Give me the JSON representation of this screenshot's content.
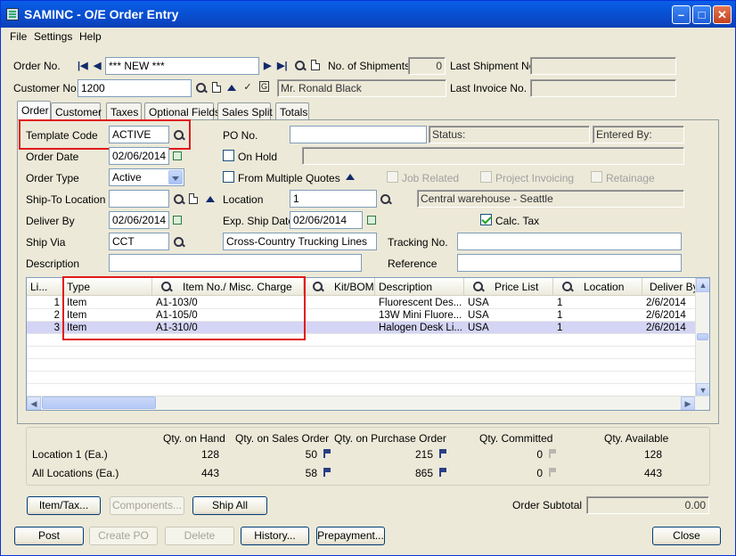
{
  "window": {
    "title": "SAMINC - O/E Order Entry"
  },
  "menu": [
    "File",
    "Settings",
    "Help"
  ],
  "header": {
    "order_no_label": "Order No.",
    "order_no_value": "*** NEW ***",
    "num_shipments_label": "No. of Shipments",
    "num_shipments_value": "0",
    "last_shipment_label": "Last Shipment No.",
    "last_shipment_value": "",
    "customer_no_label": "Customer No.",
    "customer_no_value": "1200",
    "customer_name": "Mr. Ronald Black",
    "last_invoice_label": "Last Invoice No.",
    "last_invoice_value": ""
  },
  "tabs": [
    "Order",
    "Customer",
    "Taxes",
    "Optional Fields",
    "Sales Split",
    "Totals"
  ],
  "order_tab": {
    "template_code_label": "Template Code",
    "template_code_value": "ACTIVE",
    "po_no_label": "PO No.",
    "po_no_value": "",
    "status_label": "Status:",
    "entered_by_label": "Entered By:",
    "order_date_label": "Order Date",
    "order_date_value": "02/06/2014",
    "on_hold_label": "On Hold",
    "order_type_label": "Order Type",
    "order_type_value": "Active",
    "from_multiple_quotes_label": "From Multiple Quotes",
    "job_related_label": "Job Related",
    "project_invoicing_label": "Project Invoicing",
    "retainage_label": "Retainage",
    "ship_to_label": "Ship-To Location",
    "ship_to_value": "",
    "location_label": "Location",
    "location_value": "1",
    "location_desc": "Central warehouse - Seattle",
    "deliver_by_label": "Deliver By",
    "deliver_by_value": "02/06/2014",
    "exp_ship_date_label": "Exp. Ship Date",
    "exp_ship_date_value": "02/06/2014",
    "calc_tax_label": "Calc. Tax",
    "ship_via_label": "Ship Via",
    "ship_via_value": "CCT",
    "ship_via_desc": "Cross-Country Trucking Lines",
    "tracking_no_label": "Tracking No.",
    "tracking_no_value": "",
    "description_label": "Description",
    "description_value": "",
    "reference_label": "Reference",
    "reference_value": ""
  },
  "grid": {
    "columns": [
      "Li...",
      "Type",
      "Item No./ Misc. Charge",
      "Kit/BOM",
      "Description",
      "Price List",
      "Location",
      "Deliver By"
    ],
    "rows": [
      {
        "line": "1",
        "type": "Item",
        "item": "A1-103/0",
        "kit": "",
        "desc": "Fluorescent Des...",
        "price_list": "USA",
        "location": "1",
        "deliver_by": "2/6/2014"
      },
      {
        "line": "2",
        "type": "Item",
        "item": "A1-105/0",
        "kit": "",
        "desc": "13W Mini Fluore...",
        "price_list": "USA",
        "location": "1",
        "deliver_by": "2/6/2014"
      },
      {
        "line": "3",
        "type": "Item",
        "item": "A1-310/0",
        "kit": "",
        "desc": "Halogen Desk Li...",
        "price_list": "USA",
        "location": "1",
        "deliver_by": "2/6/2014"
      }
    ]
  },
  "quantities": {
    "headers": [
      "Qty. on Hand",
      "Qty. on Sales Order",
      "Qty. on Purchase Order",
      "Qty. Committed",
      "Qty. Available"
    ],
    "rows": [
      {
        "label": "Location  1 (Ea.)",
        "on_hand": "128",
        "on_so": "50",
        "on_po": "215",
        "committed": "0",
        "available": "128"
      },
      {
        "label": "All Locations (Ea.)",
        "on_hand": "443",
        "on_so": "58",
        "on_po": "865",
        "committed": "0",
        "available": "443"
      }
    ]
  },
  "lower_buttons": {
    "item_tax": "Item/Tax...",
    "components": "Components...",
    "ship_all": "Ship All"
  },
  "order_subtotal_label": "Order Subtotal",
  "order_subtotal_value": "0.00",
  "footer_buttons": {
    "post": "Post",
    "create_po": "Create PO",
    "delete": "Delete",
    "history": "History...",
    "prepayment": "Prepayment...",
    "close": "Close"
  }
}
